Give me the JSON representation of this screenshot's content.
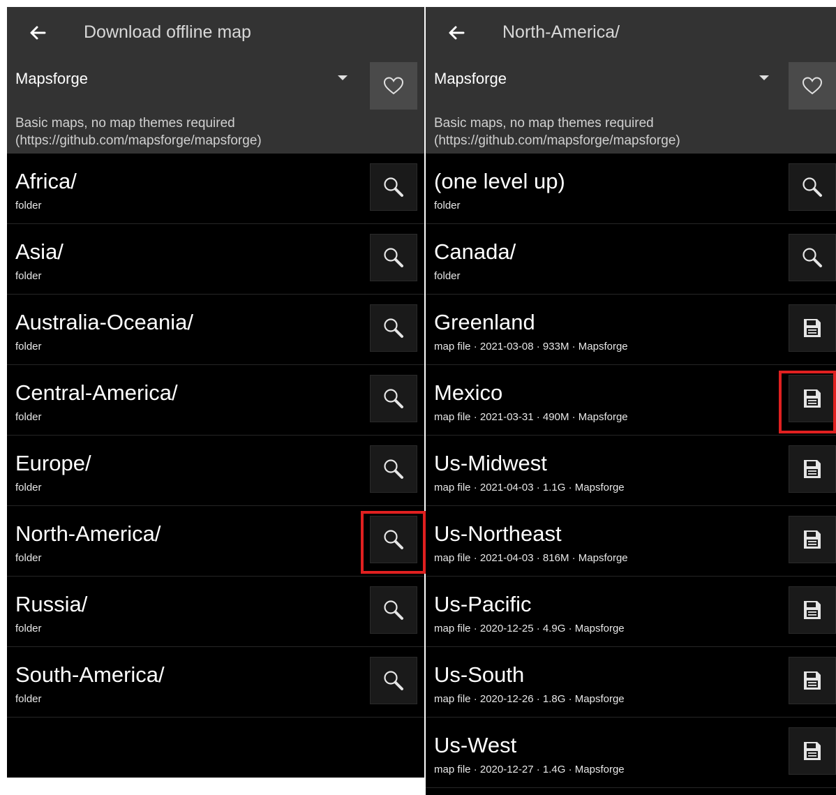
{
  "left": {
    "title": "Download offline map",
    "source": {
      "name": "Mapsforge",
      "description_line1": "Basic maps, no map themes required",
      "description_line2": "(https://github.com/mapsforge/mapsforge)"
    },
    "items": [
      {
        "title": "Africa/",
        "subtitle": "folder"
      },
      {
        "title": "Asia/",
        "subtitle": "folder"
      },
      {
        "title": "Australia-Oceania/",
        "subtitle": "folder"
      },
      {
        "title": "Central-America/",
        "subtitle": "folder"
      },
      {
        "title": "Europe/",
        "subtitle": "folder"
      },
      {
        "title": "North-America/",
        "subtitle": "folder"
      },
      {
        "title": "Russia/",
        "subtitle": "folder"
      },
      {
        "title": "South-America/",
        "subtitle": "folder"
      }
    ]
  },
  "right": {
    "title": "North-America/",
    "source": {
      "name": "Mapsforge",
      "description_line1": "Basic maps, no map themes required",
      "description_line2": "(https://github.com/mapsforge/mapsforge)"
    },
    "items": [
      {
        "title": "(one level up)",
        "subtitle": "folder",
        "action": "search-icon"
      },
      {
        "title": "Canada/",
        "subtitle": "folder",
        "action": "search-icon"
      },
      {
        "title": "Greenland",
        "subtitle": "map file · 2021-03-08 · 933M · Mapsforge",
        "action": "save-icon"
      },
      {
        "title": "Mexico",
        "subtitle": "map file · 2021-03-31 · 490M · Mapsforge",
        "action": "save-icon"
      },
      {
        "title": "Us-Midwest",
        "subtitle": "map file · 2021-04-03 · 1.1G · Mapsforge",
        "action": "save-icon"
      },
      {
        "title": "Us-Northeast",
        "subtitle": "map file · 2021-04-03 · 816M · Mapsforge",
        "action": "save-icon"
      },
      {
        "title": "Us-Pacific",
        "subtitle": "map file · 2020-12-25 · 4.9G · Mapsforge",
        "action": "save-icon"
      },
      {
        "title": "Us-South",
        "subtitle": "map file · 2020-12-26 · 1.8G · Mapsforge",
        "action": "save-icon"
      },
      {
        "title": "Us-West",
        "subtitle": "map file · 2020-12-27 · 1.4G · Mapsforge",
        "action": "save-icon"
      }
    ]
  },
  "colors": {
    "appbar_bg": "#333333",
    "list_bg": "#000000",
    "highlight": "#e02020"
  }
}
